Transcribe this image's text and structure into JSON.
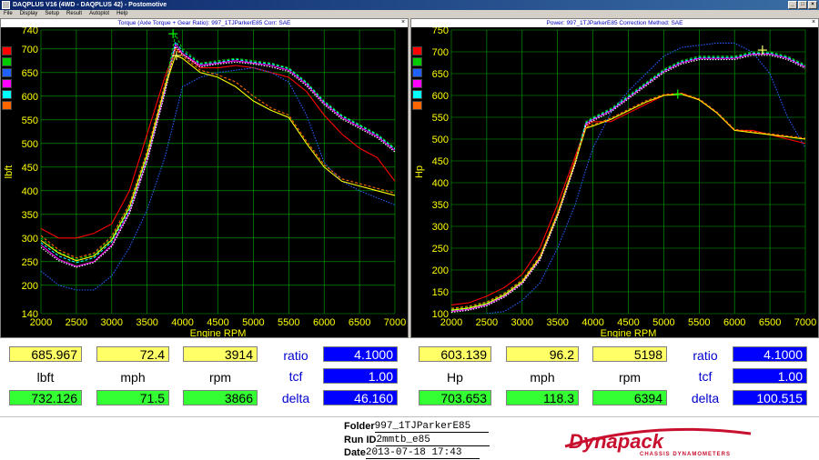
{
  "window": {
    "title": "DAQPLUS V16 (4WD - DAQPLUS 42) - Postomotive",
    "controls": [
      "_",
      "□",
      "×"
    ]
  },
  "menu": [
    "File",
    "Display",
    "Setup",
    "Result",
    "Autoplot",
    "Help"
  ],
  "colors": {
    "swatches": [
      "#ff0000",
      "#00cc00",
      "#2060ff",
      "#ff00ff",
      "#00ffff",
      "#ff6600"
    ],
    "plot_bg": "#000000",
    "grid": "#00aa00",
    "axis_text": "#ffff00"
  },
  "left_panel": {
    "title": "Torque (Axle Torque + Gear Ratio): 997_1TJParkerE85      Corr: SAE",
    "close": "×"
  },
  "right_panel": {
    "title": "Power: 997_1TJParkerE85      Correction Method: SAE",
    "close": "×"
  },
  "chart_data": [
    {
      "type": "line",
      "title": "Torque (Axle Torque + Gear Ratio): 997_1TJParkerE85      Corr: SAE",
      "xlabel": "Engine RPM",
      "ylabel": "lbft",
      "xlim": [
        2000,
        7000
      ],
      "ylim": [
        140,
        740
      ],
      "x_ticks": [
        2000,
        2500,
        3000,
        3500,
        4000,
        4500,
        5000,
        5500,
        6000,
        6500,
        7000
      ],
      "y_ticks": [
        140,
        200,
        250,
        300,
        350,
        400,
        450,
        500,
        550,
        600,
        650,
        700,
        740
      ],
      "y_tick_labels": [
        "140",
        "200",
        "250",
        "300",
        "350",
        "400",
        "450",
        "500",
        "550",
        "600",
        "650",
        "700",
        "740"
      ],
      "grid": true,
      "markers": [
        {
          "x": 3866,
          "y": 732
        },
        {
          "x": 3914,
          "y": 686
        }
      ],
      "series": [
        {
          "color": "#ff0000",
          "x": [
            2000,
            2250,
            2500,
            2750,
            3000,
            3250,
            3500,
            3750,
            3900,
            4000,
            4250,
            4500,
            4750,
            5000,
            5250,
            5500,
            5750,
            6000,
            6250,
            6500,
            6750,
            7000
          ],
          "y": [
            320,
            300,
            300,
            310,
            330,
            400,
            520,
            640,
            700,
            690,
            660,
            660,
            665,
            660,
            650,
            640,
            610,
            560,
            520,
            490,
            470,
            420
          ]
        },
        {
          "color": "#00cc00",
          "x": [
            2000,
            2250,
            2500,
            2750,
            3000,
            3250,
            3500,
            3750,
            3900,
            4000,
            4250,
            4500,
            4750,
            5000,
            5250,
            5500,
            5750,
            6000,
            6250,
            6500,
            6750,
            7000
          ],
          "y": [
            300,
            270,
            255,
            265,
            300,
            370,
            480,
            620,
            730,
            700,
            670,
            675,
            680,
            675,
            670,
            660,
            630,
            590,
            560,
            540,
            520,
            490
          ]
        },
        {
          "color": "#2060ff",
          "x": [
            2000,
            2250,
            2500,
            2750,
            3000,
            3250,
            3500,
            3750,
            3900,
            4000,
            4250,
            4500,
            4750,
            5000,
            5250,
            5500,
            5750,
            6000,
            6250,
            6500,
            6750,
            7000
          ],
          "y": [
            230,
            200,
            190,
            190,
            220,
            280,
            360,
            470,
            560,
            620,
            640,
            650,
            655,
            660,
            650,
            630,
            560,
            460,
            420,
            400,
            385,
            370
          ]
        },
        {
          "color": "#ff00ff",
          "x": [
            2000,
            2250,
            2500,
            2750,
            3000,
            3250,
            3500,
            3750,
            3900,
            4000,
            4250,
            4500,
            4750,
            5000,
            5250,
            5500,
            5750,
            6000,
            6250,
            6500,
            6750,
            7000
          ],
          "y": [
            285,
            255,
            240,
            250,
            285,
            355,
            465,
            610,
            710,
            690,
            665,
            670,
            675,
            670,
            665,
            655,
            625,
            585,
            555,
            535,
            515,
            485
          ]
        },
        {
          "color": "#00ffff",
          "x": [
            2000,
            2250,
            2500,
            2750,
            3000,
            3250,
            3500,
            3750,
            3900,
            4000,
            4250,
            4500,
            4750,
            5000,
            5250,
            5500,
            5750,
            6000,
            6250,
            6500,
            6750,
            7000
          ],
          "y": [
            290,
            262,
            248,
            258,
            292,
            360,
            472,
            615,
            715,
            695,
            668,
            672,
            678,
            672,
            668,
            658,
            628,
            588,
            558,
            538,
            518,
            488
          ]
        },
        {
          "color": "#ffffff",
          "x": [
            2000,
            2250,
            2500,
            2750,
            3000,
            3250,
            3500,
            3750,
            3900,
            4000,
            4250,
            4500,
            4750,
            5000,
            5250,
            5500,
            5750,
            6000,
            6250,
            6500,
            6750,
            7000
          ],
          "y": [
            280,
            252,
            238,
            248,
            282,
            352,
            462,
            605,
            705,
            688,
            662,
            668,
            672,
            668,
            662,
            652,
            622,
            582,
            552,
            532,
            512,
            482
          ]
        },
        {
          "color": "#ffff00",
          "x": [
            2000,
            2250,
            2500,
            2750,
            3000,
            3250,
            3500,
            3750,
            3900,
            4000,
            4250,
            4500,
            4750,
            5000,
            5250,
            5500,
            5750,
            6000,
            6250,
            6500,
            6750,
            7000
          ],
          "y": [
            295,
            268,
            252,
            262,
            296,
            365,
            476,
            618,
            686,
            680,
            650,
            640,
            620,
            590,
            570,
            555,
            500,
            450,
            420,
            410,
            400,
            390
          ]
        },
        {
          "color": "#ff6600",
          "x": [
            2000,
            2250,
            2500,
            2750,
            3000,
            3250,
            3500,
            3750,
            3900,
            4000,
            4250,
            4500,
            4750,
            5000,
            5250,
            5500,
            5750,
            6000,
            6250,
            6500,
            6750,
            7000
          ],
          "y": [
            305,
            275,
            258,
            268,
            304,
            372,
            484,
            625,
            700,
            685,
            655,
            645,
            630,
            600,
            575,
            560,
            505,
            455,
            425,
            415,
            405,
            395
          ]
        }
      ]
    },
    {
      "type": "line",
      "title": "Power: 997_1TJParkerE85      Correction Method: SAE",
      "xlabel": "Engine RPM",
      "ylabel": "Hp",
      "xlim": [
        2000,
        7000
      ],
      "ylim": [
        100,
        750
      ],
      "x_ticks": [
        2000,
        2500,
        3000,
        3500,
        4000,
        4500,
        5000,
        5500,
        6000,
        6500,
        7000
      ],
      "y_ticks": [
        100,
        150,
        200,
        250,
        300,
        350,
        400,
        450,
        500,
        550,
        600,
        650,
        700,
        750
      ],
      "y_tick_labels": [
        "100",
        "150",
        "200",
        "250",
        "300",
        "350",
        "400",
        "450",
        "500",
        "550",
        "600",
        "650",
        "700",
        "750"
      ],
      "grid": true,
      "markers": [
        {
          "x": 5198,
          "y": 603
        },
        {
          "x": 6394,
          "y": 704
        }
      ],
      "series": [
        {
          "color": "#ff0000",
          "x": [
            2000,
            2250,
            2500,
            2750,
            3000,
            3250,
            3500,
            3750,
            3900,
            4000,
            4250,
            4500,
            4750,
            5000,
            5250,
            5500,
            5750,
            6000,
            6250,
            6500,
            6750,
            7000
          ],
          "y": [
            120,
            125,
            140,
            160,
            190,
            250,
            350,
            460,
            530,
            540,
            540,
            560,
            580,
            600,
            605,
            590,
            560,
            520,
            520,
            510,
            500,
            490
          ]
        },
        {
          "color": "#00cc00",
          "x": [
            2000,
            2250,
            2500,
            2750,
            3000,
            3250,
            3500,
            3750,
            3900,
            4000,
            4250,
            4500,
            4750,
            5000,
            5250,
            5500,
            5750,
            6000,
            6250,
            6500,
            6750,
            7000
          ],
          "y": [
            110,
            115,
            125,
            145,
            175,
            230,
            330,
            450,
            540,
            550,
            570,
            600,
            630,
            660,
            680,
            690,
            690,
            690,
            700,
            700,
            690,
            670
          ]
        },
        {
          "color": "#2060ff",
          "x": [
            2000,
            2250,
            2500,
            2750,
            3000,
            3250,
            3500,
            3750,
            3900,
            4000,
            4250,
            4500,
            4750,
            5000,
            5250,
            5500,
            5750,
            6000,
            6250,
            6500,
            6750,
            7000
          ],
          "y": [
            90,
            95,
            100,
            105,
            130,
            170,
            250,
            350,
            430,
            480,
            560,
            610,
            650,
            690,
            710,
            715,
            720,
            720,
            700,
            650,
            550,
            480
          ]
        },
        {
          "color": "#ff00ff",
          "x": [
            2000,
            2250,
            2500,
            2750,
            3000,
            3250,
            3500,
            3750,
            3900,
            4000,
            4250,
            4500,
            4750,
            5000,
            5250,
            5500,
            5750,
            6000,
            6250,
            6500,
            6750,
            7000
          ],
          "y": [
            105,
            110,
            120,
            140,
            170,
            225,
            325,
            445,
            535,
            545,
            565,
            595,
            625,
            655,
            675,
            685,
            685,
            685,
            695,
            695,
            685,
            665
          ]
        },
        {
          "color": "#00ffff",
          "x": [
            2000,
            2250,
            2500,
            2750,
            3000,
            3250,
            3500,
            3750,
            3900,
            4000,
            4250,
            4500,
            4750,
            5000,
            5250,
            5500,
            5750,
            6000,
            6250,
            6500,
            6750,
            7000
          ],
          "y": [
            107,
            112,
            122,
            142,
            172,
            228,
            328,
            448,
            537,
            547,
            567,
            597,
            627,
            657,
            677,
            687,
            687,
            687,
            697,
            697,
            687,
            667
          ]
        },
        {
          "color": "#ffffff",
          "x": [
            2000,
            2250,
            2500,
            2750,
            3000,
            3250,
            3500,
            3750,
            3900,
            4000,
            4250,
            4500,
            4750,
            5000,
            5250,
            5500,
            5750,
            6000,
            6250,
            6500,
            6750,
            7000
          ],
          "y": [
            103,
            108,
            118,
            138,
            168,
            222,
            322,
            442,
            532,
            542,
            562,
            592,
            622,
            652,
            672,
            682,
            682,
            682,
            692,
            692,
            682,
            662
          ]
        },
        {
          "color": "#ffff00",
          "x": [
            2000,
            2250,
            2500,
            2750,
            3000,
            3250,
            3500,
            3750,
            3900,
            4000,
            4250,
            4500,
            4750,
            5000,
            5250,
            5500,
            5750,
            6000,
            6250,
            6500,
            6750,
            7000
          ],
          "y": [
            108,
            113,
            123,
            143,
            173,
            228,
            328,
            448,
            525,
            530,
            545,
            565,
            585,
            600,
            603,
            590,
            560,
            520,
            515,
            510,
            505,
            500
          ]
        },
        {
          "color": "#ff6600",
          "x": [
            2000,
            2250,
            2500,
            2750,
            3000,
            3250,
            3500,
            3750,
            3900,
            4000,
            4250,
            4500,
            4750,
            5000,
            5250,
            5500,
            5750,
            6000,
            6250,
            6500,
            6750,
            7000
          ],
          "y": [
            112,
            117,
            127,
            147,
            177,
            232,
            332,
            452,
            528,
            533,
            548,
            568,
            588,
            602,
            605,
            592,
            562,
            522,
            517,
            512,
            507,
            502
          ]
        }
      ]
    }
  ],
  "readouts": {
    "left": {
      "row1": [
        "685.967",
        "72.4",
        "3914"
      ],
      "units": [
        "lbft",
        "mph",
        "rpm"
      ],
      "row2": [
        "732.126",
        "71.5",
        "3866"
      ],
      "labels": [
        "ratio",
        "tcf",
        "delta"
      ],
      "values": [
        "4.1000",
        "1.00",
        "46.160"
      ]
    },
    "right": {
      "row1": [
        "603.139",
        "96.2",
        "5198"
      ],
      "units": [
        "Hp",
        "mph",
        "rpm"
      ],
      "row2": [
        "703.653",
        "118.3",
        "6394"
      ],
      "labels": [
        "ratio",
        "tcf",
        "delta"
      ],
      "values": [
        "4.1000",
        "1.00",
        "100.515"
      ]
    }
  },
  "footer": {
    "folder_label": "Folder",
    "folder_value": "997_1TJParkerE85",
    "run_label": "Run ID",
    "run_value": "2mmtb_e85",
    "date_label": "Date",
    "date_value": "2013-07-18 17:43",
    "logo_text": "Dynapack",
    "logo_sub": "CHASSIS DYNAMOMETERS"
  }
}
